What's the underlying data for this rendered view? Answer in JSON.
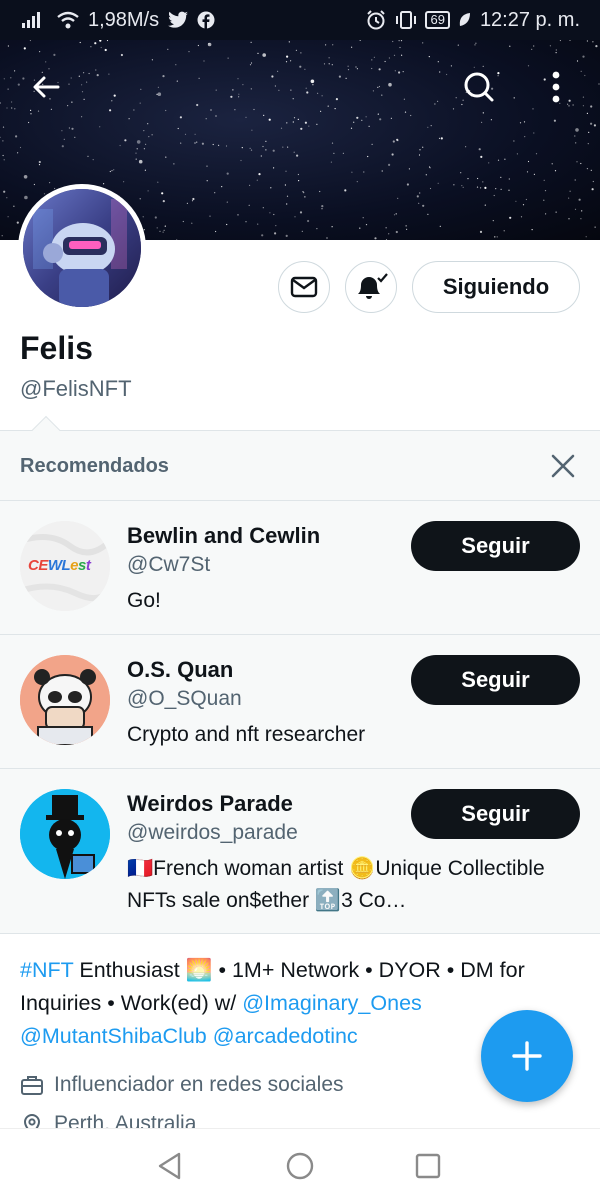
{
  "status_bar": {
    "net_speed": "1,98M/s",
    "battery": "69",
    "time": "12:27 p. m."
  },
  "profile": {
    "name": "Felis",
    "handle": "@FelisNFT",
    "following_label": "Siguiendo"
  },
  "recommendations": {
    "title": "Recomendados",
    "items": [
      {
        "name": "Bewlin and Cewlin",
        "handle": "@Cw7St",
        "bio": "Go!",
        "button": "Seguir",
        "avatar_text": "CEWLest"
      },
      {
        "name": "O.S. Quan",
        "handle": "@O_SQuan",
        "bio": "Crypto and nft researcher",
        "button": "Seguir"
      },
      {
        "name": "Weirdos Parade",
        "handle": "@weirdos_parade",
        "bio": "🇫🇷French woman artist 🪙Unique Collectible NFTs sale on$ether 🔝3 Co…",
        "button": "Seguir"
      }
    ]
  },
  "bio": {
    "hashtag": "#NFT",
    "line1_rest": " Enthusiast 🌅 • 1M+ Network • DYOR  • DM for Inquiries •   Work(ed) w/ ",
    "mention1": "@Imaginary_Ones",
    "mention2": "@MutantShibaClub",
    "mention3": "@arcadedotinc"
  },
  "meta": {
    "category": "Influenciador en redes sociales",
    "location": "Perth, Australia"
  },
  "colors": {
    "accent": "#1d9bf0",
    "text": "#0f1419",
    "secondary": "#536471",
    "button_dark": "#0f1419"
  },
  "icons": [
    "back-arrow-icon",
    "search-icon",
    "more-vert-icon",
    "mail-icon",
    "bell-icon",
    "close-icon",
    "plus-icon",
    "briefcase-icon",
    "location-icon",
    "nav-back-icon",
    "nav-home-icon",
    "nav-recents-icon"
  ]
}
